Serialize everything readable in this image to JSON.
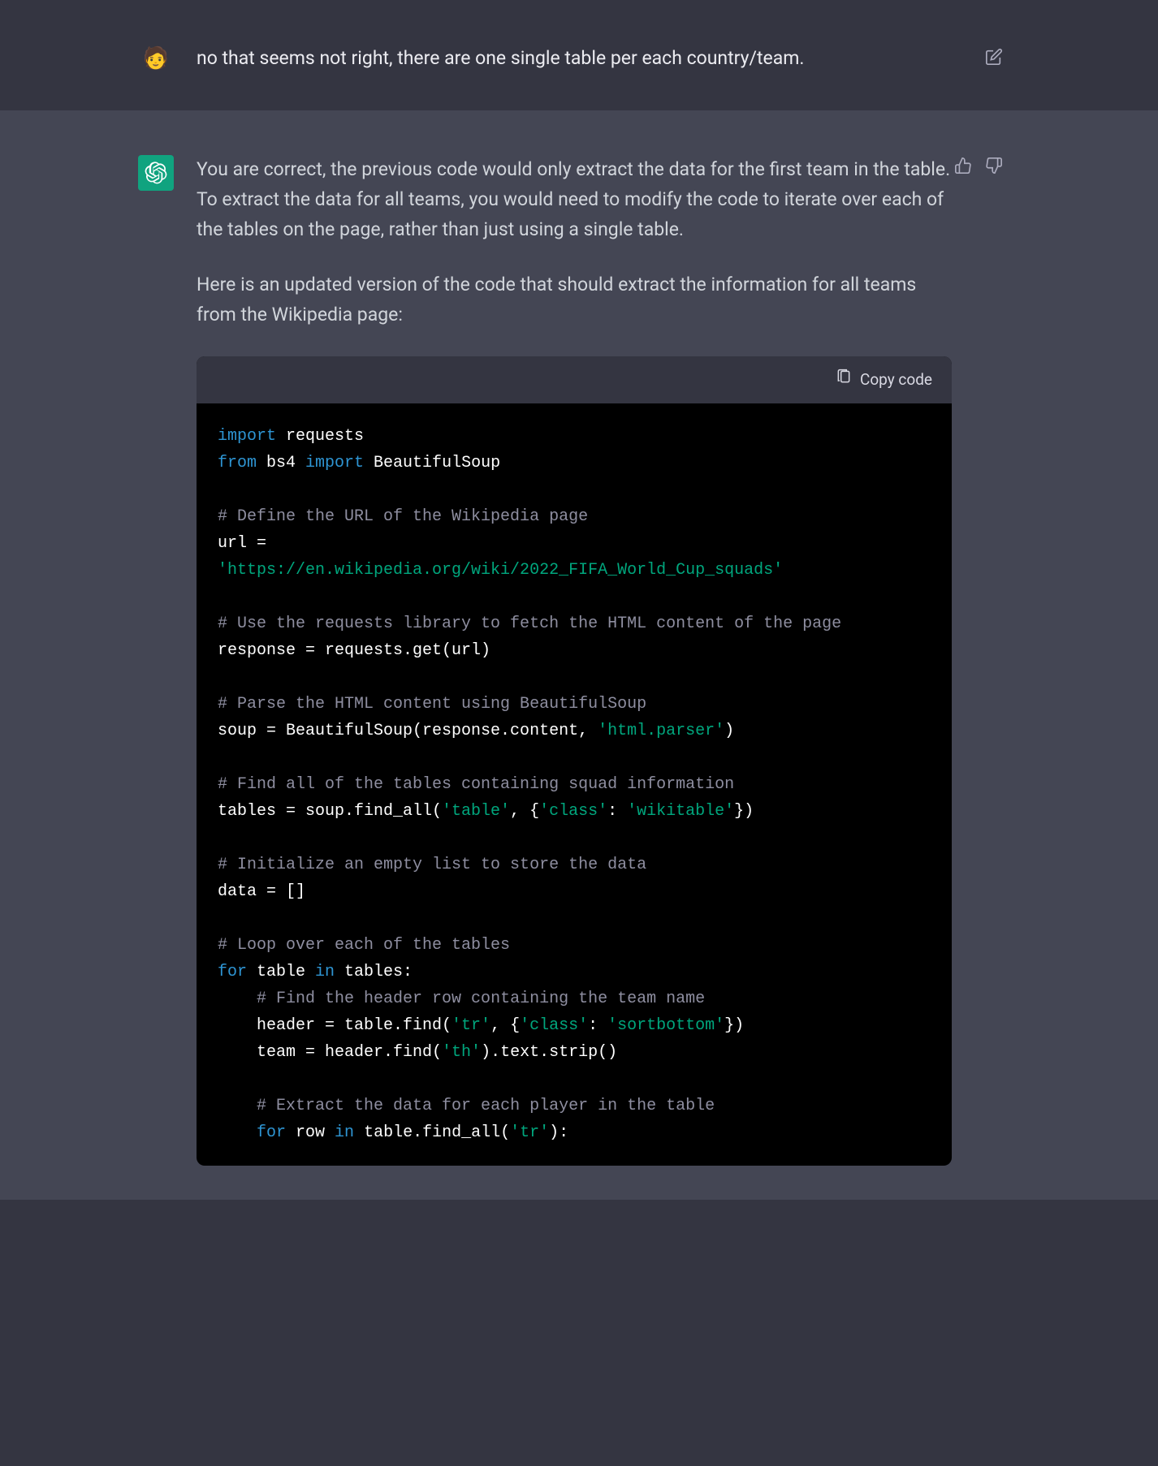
{
  "user": {
    "message": "no that seems not right, there are one single table per each country/team."
  },
  "assistant": {
    "para1": "You are correct, the previous code would only extract the data for the first team in the table. To extract the data for all teams, you would need to modify the code to iterate over each of the tables on the page, rather than just using a single table.",
    "para2": "Here is an updated version of the code that should extract the information for all teams from the Wikipedia page:"
  },
  "code": {
    "copy_label": "Copy code",
    "t_import": "import",
    "t_requests": " requests",
    "t_from": "from",
    "t_bs4": " bs4 ",
    "t_import2": "import",
    "t_beautifulsoup": " BeautifulSoup",
    "c1": "# Define the URL of the Wikipedia page",
    "l_url": "url = ",
    "s_url": "'https://en.wikipedia.org/wiki/2022_FIFA_World_Cup_squads'",
    "c2": "# Use the requests library to fetch the HTML content of the page",
    "l_response": "response = requests.get(url)",
    "c3": "# Parse the HTML content using BeautifulSoup",
    "l_soup1": "soup = BeautifulSoup(response.content, ",
    "s_parser": "'html.parser'",
    "l_soup2": ")",
    "c4": "# Find all of the tables containing squad information",
    "l_tables1": "tables = soup.find_all(",
    "s_table": "'table'",
    "l_tables2": ", {",
    "s_class": "'class'",
    "l_tables3": ": ",
    "s_wikitable": "'wikitable'",
    "l_tables4": "})",
    "c5": "# Initialize an empty list to store the data",
    "l_data": "data = []",
    "c6": "# Loop over each of the tables",
    "t_for": "for",
    "l_for1": " table ",
    "t_in": "in",
    "l_for2": " tables:",
    "c7": "# Find the header row containing the team name",
    "l_header1": "    header = table.find(",
    "s_tr": "'tr'",
    "l_header2": ", {",
    "s_class2": "'class'",
    "l_header3": ": ",
    "s_sortbottom": "'sortbottom'",
    "l_header4": "})",
    "l_team1": "    team = header.find(",
    "s_th": "'th'",
    "l_team2": ").text.strip()",
    "c8": "# Extract the data for each player in the table",
    "l_for3": "    ",
    "t_for2": "for",
    "l_for4": " row ",
    "t_in2": "in",
    "l_for5": " table.find_all(",
    "s_tr2": "'tr'",
    "l_for6": "):"
  }
}
